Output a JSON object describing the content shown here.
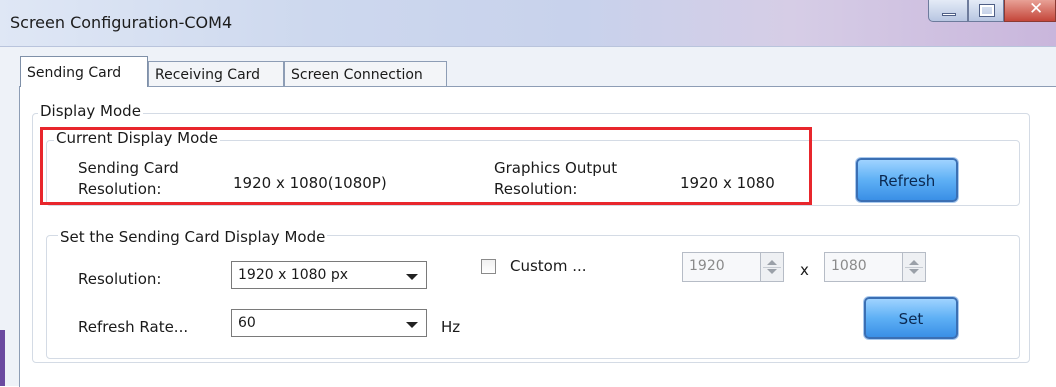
{
  "window": {
    "title": "Screen Configuration-COM4"
  },
  "tabs": [
    {
      "label": "Sending Card",
      "active": true
    },
    {
      "label": "Receiving Card",
      "active": false
    },
    {
      "label": "Screen Connection",
      "active": false
    }
  ],
  "display_mode": {
    "group_label": "Display Mode",
    "current": {
      "group_label": "Current Display Mode",
      "sending_card_label_line1": "Sending Card",
      "sending_card_label_line2": "Resolution:",
      "sending_card_value": "1920 x 1080(1080P)",
      "graphics_label_line1": "Graphics Output",
      "graphics_label_line2": "Resolution:",
      "graphics_value": "1920 x 1080",
      "refresh_button": "Refresh"
    },
    "set": {
      "group_label": "Set the Sending Card Display Mode",
      "resolution_label": "Resolution:",
      "resolution_value": "1920 x 1080 px",
      "refresh_rate_label": "Refresh Rate...",
      "refresh_rate_value": "60",
      "hz_label": "Hz",
      "custom_label": "Custom ...",
      "custom_checked": false,
      "width_value": "1920",
      "x_label": "x",
      "height_value": "1080",
      "set_button": "Set"
    }
  },
  "colors": {
    "highlight_border": "#e8262c",
    "button_blue": "#5eb0f5"
  }
}
